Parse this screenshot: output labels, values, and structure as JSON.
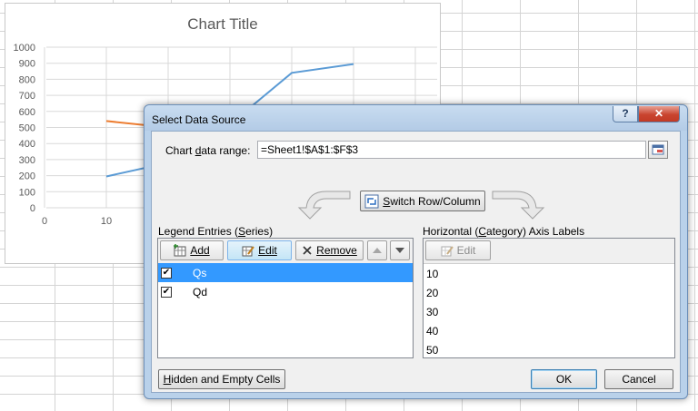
{
  "chart": {
    "title": "Chart Title",
    "y_ticks": [
      "1000",
      "900",
      "800",
      "700",
      "600",
      "500",
      "400",
      "300",
      "200",
      "100",
      "0"
    ],
    "x_ticks": [
      "0",
      "10"
    ]
  },
  "chart_data": {
    "type": "line",
    "title": "Chart Title",
    "ylim": [
      0,
      1000
    ],
    "grid": true,
    "series": [
      {
        "color": "#5b9bd5",
        "x": [
          10,
          20,
          30,
          40,
          50
        ],
        "y": [
          195,
          280,
          520,
          840,
          895
        ]
      },
      {
        "color": "#ed7d31",
        "x": [
          10,
          20
        ],
        "y": [
          540,
          500
        ]
      }
    ]
  },
  "dialog": {
    "title": "Select Data Source",
    "help_label": "?",
    "close_label": "✕",
    "range_label_pre": "Chart ",
    "range_label_u": "d",
    "range_label_post": "ata range:",
    "range_value": "=Sheet1!$A$1:$F$3",
    "switch_pre": "S",
    "switch_label": "witch Row/Column",
    "legend_pre": "Legend Entries (",
    "legend_u": "S",
    "legend_post": "eries)",
    "add_label": "Add",
    "edit_label": "Edit",
    "remove_label": "Remove",
    "series": [
      {
        "name": "Qs",
        "checked": true,
        "selected": true
      },
      {
        "name": "Qd",
        "checked": true,
        "selected": false
      }
    ],
    "axis_pre": "Horizontal (",
    "axis_u": "C",
    "axis_post": "ategory) Axis Labels",
    "axis_edit_label": "Edit",
    "categories": [
      "10",
      "20",
      "30",
      "40",
      "50"
    ],
    "hidden_cells_label": "Hidden and Empty Cells",
    "ok_label": "OK",
    "cancel_label": "Cancel",
    "colors": {
      "selection": "#3399ff",
      "titlebar": "#b9d1ea",
      "close": "#c9452f"
    }
  }
}
